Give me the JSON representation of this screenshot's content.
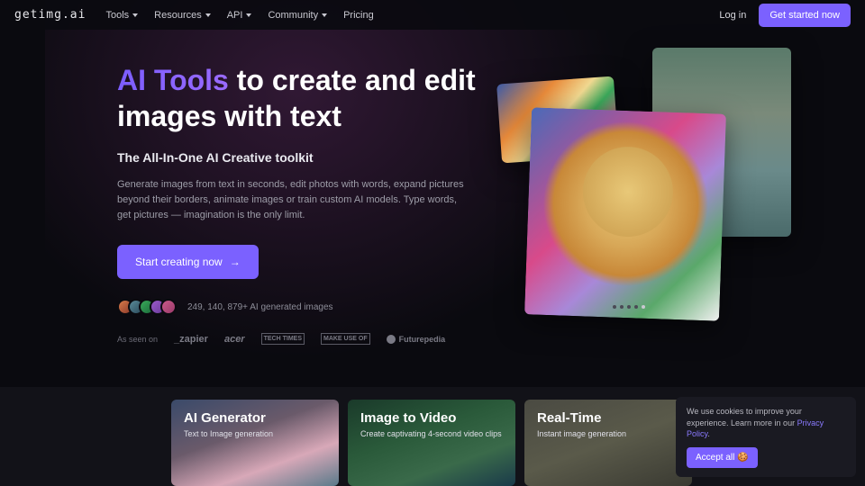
{
  "header": {
    "brand": "getimg.ai",
    "nav": [
      "Tools",
      "Resources",
      "API",
      "Community",
      "Pricing"
    ],
    "login": "Log in",
    "cta": "Get started now"
  },
  "hero": {
    "accent": "AI Tools",
    "title_rest": " to create and edit images with text",
    "subtitle": "The All-In-One AI Creative toolkit",
    "description": "Generate images from text in seconds, edit photos with words, expand pictures beyond their borders, animate images or train custom AI models. Type words, get pictures — imagination is the only limit.",
    "start_button": "Start creating now",
    "social_proof": "249, 140, 879+ AI generated images",
    "as_seen_label": "As seen on",
    "press": [
      "_zapier",
      "acer",
      "TECH TIMES",
      "MAKE USE OF",
      "Futurepedia"
    ]
  },
  "features": [
    {
      "title": "AI Generator",
      "subtitle": "Text to Image generation"
    },
    {
      "title": "Image to Video",
      "subtitle": "Create captivating 4-second video clips"
    },
    {
      "title": "Real-Time",
      "subtitle": "Instant image generation"
    }
  ],
  "cookie": {
    "text_pre": "We use cookies to improve your experience. Learn more in our ",
    "link": "Privacy Policy",
    "text_post": ".",
    "accept": "Accept all 🍪"
  }
}
